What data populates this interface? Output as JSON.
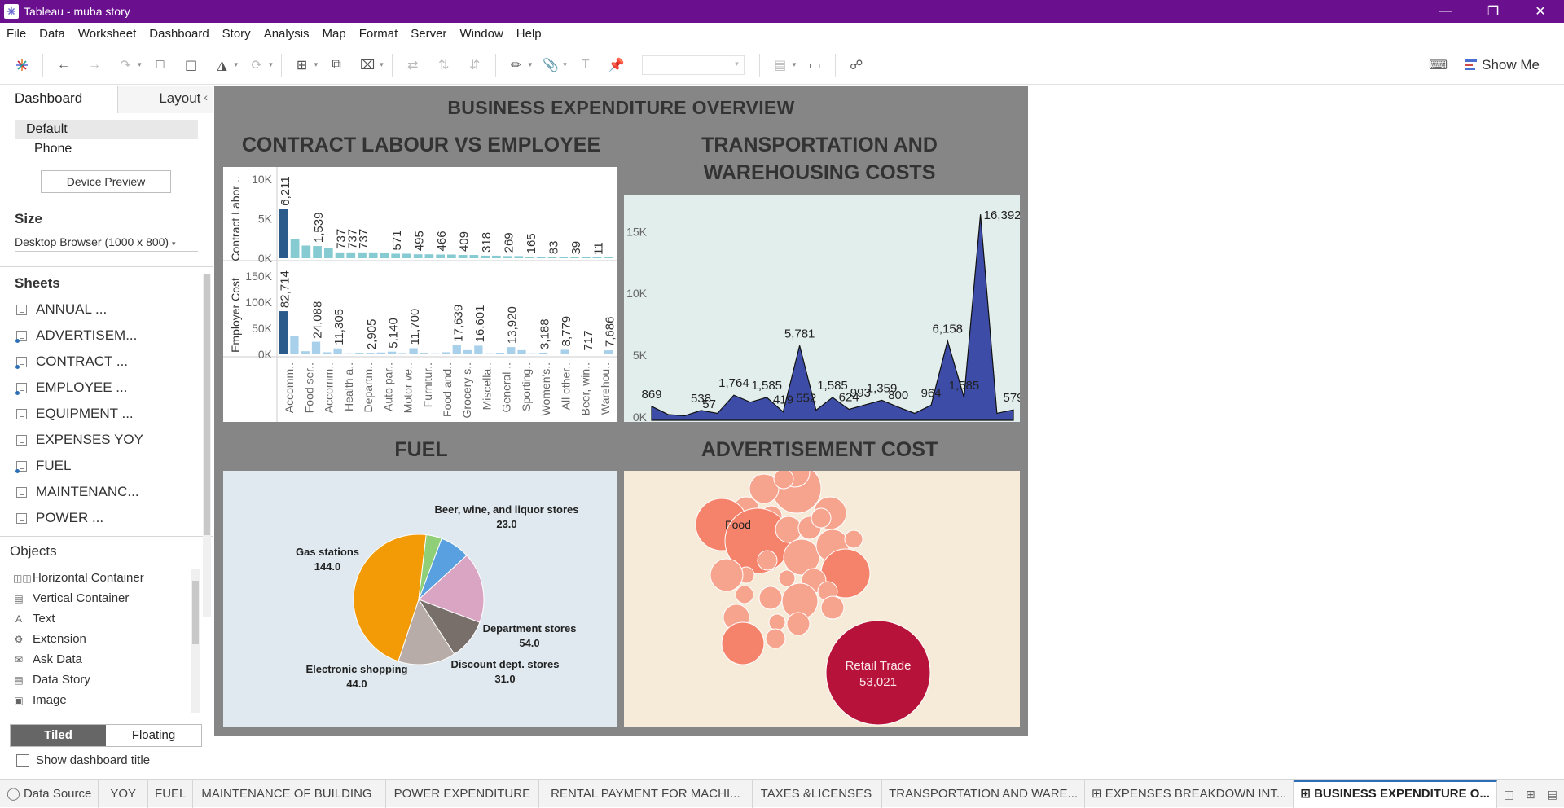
{
  "window": {
    "title": "Tableau - muba story"
  },
  "menu": [
    "File",
    "Data",
    "Worksheet",
    "Dashboard",
    "Story",
    "Analysis",
    "Map",
    "Format",
    "Server",
    "Window",
    "Help"
  ],
  "toolbar": {
    "show_me": "Show Me"
  },
  "left_panel": {
    "tabs": [
      "Dashboard",
      "Layout"
    ],
    "devices": [
      "Default",
      "Phone"
    ],
    "device_preview": "Device Preview",
    "size_title": "Size",
    "size_value": "Desktop Browser (1000 x 800)",
    "sheets_title": "Sheets",
    "sheets": [
      "ANNUAL ...",
      "ADVERTISEM...",
      "CONTRACT ...",
      "EMPLOYEE ...",
      "EQUIPMENT ...",
      "EXPENSES YOY",
      "FUEL",
      "MAINTENANC...",
      "POWER ..."
    ],
    "objects_title": "Objects",
    "objects": [
      "Horizontal Container",
      "Vertical Container",
      "Text",
      "Extension",
      "Ask Data",
      "Data Story",
      "Image"
    ],
    "layout_modes": [
      "Tiled",
      "Floating"
    ],
    "show_title_label": "Show dashboard title"
  },
  "dashboard": {
    "title": "BUSINESS EXPENDITURE OVERVIEW",
    "panels": {
      "contract": "CONTRACT LABOUR VS EMPLOYEE",
      "transport": "TRANSPORTATION AND WAREHOUSING COSTS",
      "fuel": "FUEL",
      "advert": "ADVERTISEMENT COST"
    }
  },
  "bottom_tabs": [
    "Data Source",
    "YOY",
    "FUEL",
    "MAINTENANCE OF BUILDING",
    "POWER EXPENDITURE",
    "RENTAL PAYMENT FOR MACHI...",
    "TAXES &LICENSES",
    "TRANSPORTATION AND WARE...",
    "EXPENSES BREAKDOWN INT...",
    "BUSINESS EXPENDITURE O..."
  ],
  "colors": {
    "titlebar": "#6a0f8e",
    "dashboard_bg": "#868686"
  },
  "chart_data": [
    {
      "type": "bar",
      "name_ref": "contract",
      "ylabel": "Contract Labor ..",
      "ylim": [
        0,
        10000
      ],
      "yticks": [
        "10K",
        "5K",
        "0K"
      ],
      "categories": [
        "Accomm..",
        "Food ser..",
        "Accomm..",
        "Health a..",
        "Departm..",
        "Auto par..",
        "Motor ve..",
        "Furnitur..",
        "Food and..",
        "Grocery s..",
        "Miscella..",
        "General ..",
        "Sporting..",
        "Women's..",
        "All other..",
        "Beer, win..",
        "Warehou.."
      ],
      "values": [
        6211,
        2400,
        1600,
        1539,
        1300,
        737,
        737,
        737,
        737,
        700,
        571,
        571,
        495,
        495,
        466,
        466,
        409,
        409,
        318,
        318,
        269,
        269,
        165,
        165,
        83,
        83,
        39,
        39,
        11,
        11
      ],
      "labels": [
        "6,211",
        "1,539",
        "737",
        "737",
        "737",
        "571",
        "495",
        "466",
        "409",
        "318",
        "269",
        "165",
        "83",
        "39",
        "11"
      ],
      "label_idx": [
        0,
        3,
        5,
        6,
        7,
        10,
        12,
        14,
        16,
        18,
        20,
        22,
        24,
        26,
        28
      ]
    },
    {
      "type": "bar",
      "name_ref": "employee",
      "ylabel": "Employer Cost",
      "ylim": [
        0,
        150000
      ],
      "yticks": [
        "150K",
        "100K",
        "50K",
        "0K"
      ],
      "values": [
        82714,
        35000,
        6000,
        24088,
        4000,
        11305,
        2000,
        3000,
        2905,
        3500,
        5140,
        2500,
        11700,
        3000,
        2000,
        4000,
        17639,
        8000,
        16601,
        2000,
        3000,
        13920,
        8000,
        2000,
        3188,
        1500,
        8779,
        1000,
        717,
        1200,
        7686
      ],
      "labels": [
        "82,714",
        "24,088",
        "11,305",
        "2,905",
        "5,140",
        "11,700",
        "17,639",
        "16,601",
        "13,920",
        "3,188",
        "8,779",
        "717",
        "7,686"
      ],
      "label_idx": [
        0,
        3,
        5,
        8,
        10,
        12,
        16,
        18,
        21,
        24,
        26,
        28,
        30
      ]
    },
    {
      "type": "area",
      "name_ref": "transport",
      "ylim": [
        0,
        17000
      ],
      "yticks": [
        "15K",
        "10K",
        "5K",
        "0K"
      ],
      "values": [
        869,
        200,
        100,
        538,
        300,
        1764,
        1200,
        1585,
        419,
        5781,
        552,
        1585,
        624,
        993,
        1359,
        800,
        300,
        964,
        6158,
        1585,
        16392,
        300,
        579
      ],
      "labels": [
        "869",
        "538",
        "57",
        "1,764",
        "1,585",
        "419",
        "552",
        "5,781",
        "1,585",
        "624",
        "993",
        "1,359",
        "800",
        "964",
        "6,158",
        "1,585",
        "16,392",
        "579"
      ]
    },
    {
      "type": "pie",
      "name_ref": "fuel",
      "slices": [
        {
          "label": "Beer, wine, and liquor stores",
          "value": 23.0,
          "display": "23.0",
          "color": "#58a0e0"
        },
        {
          "label": "Department stores",
          "value": 54.0,
          "display": "54.0",
          "color": "#d9a5c2"
        },
        {
          "label": "Discount dept. stores",
          "value": 31.0,
          "display": "31.0",
          "color": "#786f6b"
        },
        {
          "label": "Electronic shopping",
          "value": 44.0,
          "display": "44.0",
          "color": "#b8aca8"
        },
        {
          "label": "Gas stations",
          "value": 144.0,
          "display": "144.0",
          "color": "#f39b06"
        },
        {
          "label": "",
          "value": 12.0,
          "display": "",
          "color": "#8fcf78"
        }
      ]
    },
    {
      "type": "bubble",
      "name_ref": "advert",
      "labels": [
        {
          "text": "Food",
          "value": ""
        },
        {
          "text": "Retail Trade",
          "value": "53,021"
        }
      ]
    }
  ]
}
